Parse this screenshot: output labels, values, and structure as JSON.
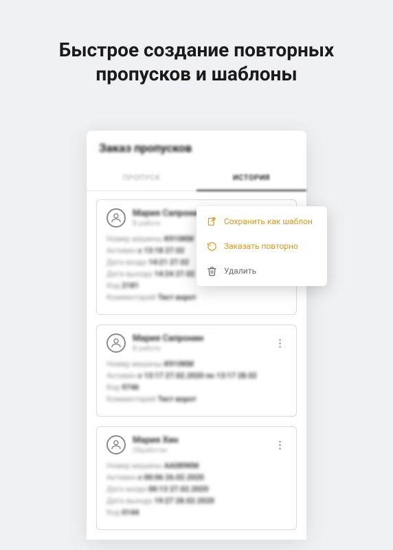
{
  "hero": "Быстрое создание повторных пропусков и шаблоны",
  "screen": {
    "title": "Заказ пропусков",
    "tabs": {
      "passes": "ПРОПУСК",
      "history": "ИСТОРИЯ"
    }
  },
  "popup": {
    "save_template": "Сохранить как шаблон",
    "reorder": "Заказать повторно",
    "delete": "Удалить"
  },
  "cards": [
    {
      "name": "Мария Сапронин",
      "sub": "В работе",
      "rows": {
        "vehicle_lbl": "Номер машины",
        "vehicle": "К910КМ",
        "active_lbl": "Активен",
        "active": "с 13:18 27.02",
        "in_lbl": "Дата входа",
        "in": "14:21 27.02",
        "out_lbl": "Дата выхода",
        "out": "14:24 27.02",
        "code_lbl": "Код",
        "code": "2181",
        "comment_lbl": "Комментарий",
        "comment": "Тест ворот"
      }
    },
    {
      "name": "Мария Сапронин",
      "sub": "В работе",
      "rows": {
        "vehicle_lbl": "Номер машины",
        "vehicle": "К910КМ",
        "active_lbl": "Активен",
        "active": "с 13:17 27.02.2020 по 13:17 28.02",
        "code_lbl": "Код",
        "code": "9746",
        "comment_lbl": "Комментарий",
        "comment": "Тест ворот"
      }
    },
    {
      "name": "Мария Хин",
      "sub": "Обработан",
      "rows": {
        "vehicle_lbl": "Номер машины",
        "vehicle": "АА089КМ",
        "active_lbl": "Активен",
        "active": "с 00:06 26.02.2020",
        "in_lbl": "Дата входа",
        "in": "00:13 27.02.2020",
        "out_lbl": "Дата выхода",
        "out": "19:27 28.02.2020",
        "code_lbl": "Код",
        "code": "0144"
      }
    }
  ]
}
